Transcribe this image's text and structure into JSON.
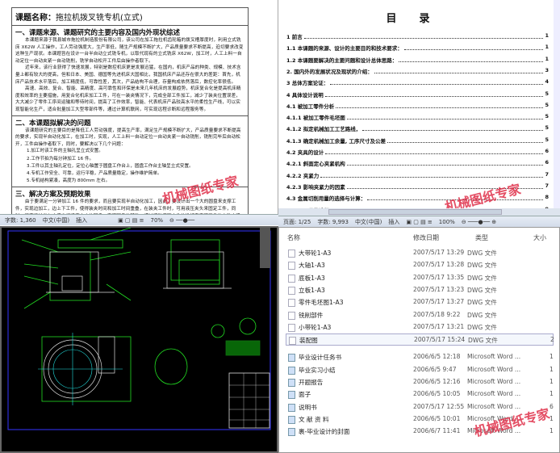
{
  "left_doc": {
    "title_label": "课题名称：",
    "title_value": "拖拉机拨叉铣专机(立式)",
    "section1": "一、课题来源、课题研究的主要内容及国内外现状综述",
    "s1_paragraphs": [
      "本课题来源于我县城市拖拉机制造股份有限公司，该公司在加工拖拉机齿轮箱的拨叉槽厚度时，利用立式铣床 X62W 人工操作，工人劳动强度大，生产率低，随生产规模不断扩大，产品质量要求不断提高，迫切要求改变这种生产现状。本课题旨在设计一台半自动立式铣专机，以取代现有的立式铣床 X62W，加工时，人工上料一自动定位一自动夹紧一自动铣削，铣学自动松开工件后由操作者取下。",
      "近年来，该行业获得了快速发展，特别是数控机床更是发展迅猛，在国内，机床产品的种类、规模、技术含量上都有较大的提高，但和日本、美国、德国等先进机床大国相比，我国机床产品还存在很大的差距：首先，机床产品技术水平落后，加工精度低，可靠性差，其次，产品结构不合理，存量构成依然落后，数控化率很低。",
      "高速、高效、复合、智能、高精度、高可靠性和环保是未来几年机床的发展趋势，机床复合化是提高机床精度和效率的主要措施，用复合化机床加工工件，可在一装夹情况下，完成全部工件加工，减少了装夹位置误差，大大减少了零件工序间运输和等待时间，提高了工作效率，智能、代表机床产品较高水平的柔性生产线，可以实现智能化生产，适合批量加工大型零部件等，通过计算机联网，可实现远程诊断和远程服务等。"
    ],
    "section2": "二、本课题拟解决的问题",
    "s2_paragraph": "该课题研究的主要目的是降低工人劳动强度，提高生产率，满足生产规模不断扩大，产品质量要求不断提高的要求，实现半自动化加工，在加工时，实现，人工上料一自动定位一自动夹紧一自动铣削，铣削完毕后自动松开，工件由操作者取下，同时，要解决以下几个问题：",
    "s2_items": [
      "1.加工时该工件的主轴孔呈立式安置。",
      "2.工作节拍为每分钟加工 16 件。",
      "3.工件以其主轴孔定位，定位心轴置于圆盘工作台上，圆盘工作台主轴呈立式安置。",
      "4.专机工作安全、可靠，运行平稳，产品质量稳定，操作维护简单。",
      "5.专机结构紧凑，高度为 800mm 左右。"
    ],
    "section3": "三、解决方案及预期效果",
    "s3_paragraph": "由于要满足一分钟加工 16 件的要求，而且要实现半自动化加工，因此，要设计出一个大的圆盘来支撑工件，实现边加工，边上下工件，使得装夹时间和加工时间重叠，在装夹工件时，可用液压夹头来固定工件，同时，还要设计出与支撑台相适应大小的圆盘，实现圆盘的转动，通过液动液压夹头的推杆来实现工件的自动夹紧和自动松开，除了液压夹头，还要设计固定液夹头"
  },
  "left_status": {
    "word_count": "字数: 1,360",
    "language": "中文(中国)",
    "mode": "插入",
    "zoom": "70%"
  },
  "toc": {
    "heading": "目录",
    "entries": [
      {
        "t": "1 前言",
        "p": "1"
      },
      {
        "t": "1.1 本课题的来源、设计的主要目的和技术要求：",
        "p": "1"
      },
      {
        "t": "1.2 本课题要解决的主要问题和设计总体思路：",
        "p": "1"
      },
      {
        "t": "2. 国内外的发展状况及现状的介绍：",
        "p": "3"
      },
      {
        "t": "3 总体方案论证：",
        "p": "4"
      },
      {
        "t": "4 具体设计说明",
        "p": "5"
      },
      {
        "t": "4.1 被加工零件分析",
        "p": "5"
      },
      {
        "t": "4.1.1 被加工零件毛坯图",
        "p": "5"
      },
      {
        "t": "4.1.2 拟定机械加工工艺路线，",
        "p": "5"
      },
      {
        "t": "4.1.3 确定机械加工余量, 工序尺寸及公差",
        "p": "5"
      },
      {
        "t": "4.2 夹具的设计",
        "p": "6"
      },
      {
        "t": "4.2.1 斜面定心夹紧机构",
        "p": "6"
      },
      {
        "t": "4.2.2 夹紧力",
        "p": "7"
      },
      {
        "t": "4.2.3 影响夹紧力的因素",
        "p": "7"
      },
      {
        "t": "4.3 金属切削用量的选择与计算：",
        "p": "8"
      },
      {
        "t": "4.3.1 刀具的选择：",
        "p": "9"
      }
    ]
  },
  "right_status": {
    "page": "页面: 1/25",
    "word_count": "字数: 9,993",
    "language": "中文(中国)",
    "mode": "插入",
    "zoom": "100%"
  },
  "explorer": {
    "columns": [
      "名称",
      "修改日期",
      "类型",
      "大小"
    ],
    "files": [
      {
        "name": "大带轮1-A3",
        "date": "2007/5/17 13:29",
        "type": "DWG 文件",
        "size": "",
        "icon": "dwg-file-icon"
      },
      {
        "name": "大轴1-A3",
        "date": "2007/5/17 13:28",
        "type": "DWG 文件",
        "size": "",
        "icon": "dwg-file-icon"
      },
      {
        "name": "底板1-A3",
        "date": "2007/5/17 13:35",
        "type": "DWG 文件",
        "size": "",
        "icon": "dwg-file-icon"
      },
      {
        "name": "立板1-A3",
        "date": "2007/5/17 13:23",
        "type": "DWG 文件",
        "size": "",
        "icon": "dwg-file-icon"
      },
      {
        "name": "零件毛坯图1-A3",
        "date": "2007/5/17 13:27",
        "type": "DWG 文件",
        "size": "",
        "icon": "dwg-file-icon"
      },
      {
        "name": "铣削部件",
        "date": "2007/5/18 9:22",
        "type": "DWG 文件",
        "size": "",
        "icon": "dwg-file-icon"
      },
      {
        "name": "小带轮1-A3",
        "date": "2007/5/17 13:21",
        "type": "DWG 文件",
        "size": "",
        "icon": "dwg-file-icon"
      },
      {
        "name": "装配图",
        "date": "2007/5/17 15:24",
        "type": "DWG 文件",
        "size": "2",
        "icon": "dwg-file-icon",
        "selected": true
      },
      {
        "name": "毕业设计任务书",
        "date": "2006/6/5 12:18",
        "type": "Microsoft Word ...",
        "size": "1",
        "icon": "word-file-icon"
      },
      {
        "name": "毕业实习小结",
        "date": "2006/6/5 9:47",
        "type": "Microsoft Word ...",
        "size": "1",
        "icon": "word-file-icon"
      },
      {
        "name": "开题报告",
        "date": "2006/6/5 12:16",
        "type": "Microsoft Word ...",
        "size": "1",
        "icon": "word-file-icon"
      },
      {
        "name": "面子",
        "date": "2006/6/5 10:05",
        "type": "Microsoft Word ...",
        "size": "1",
        "icon": "word-file-icon"
      },
      {
        "name": "说明书",
        "date": "2007/5/17 12:55",
        "type": "Microsoft Word ...",
        "size": "6",
        "icon": "word-file-icon"
      },
      {
        "name": "文 献 资 料",
        "date": "2006/6/5 10:01",
        "type": "Microsoft Word ...",
        "size": "1",
        "icon": "word-file-icon"
      },
      {
        "name": "裹-毕业设计的封面",
        "date": "2006/6/7 11:41",
        "type": "Microsoft Word ...",
        "size": "1",
        "icon": "word-file-icon"
      }
    ]
  },
  "watermark": "机械图纸专家",
  "colors": {
    "cad_bg": "#000000",
    "cad_line_green": "#22dd22",
    "cad_line_white": "#dddddd",
    "watermark": "#e0304a"
  }
}
